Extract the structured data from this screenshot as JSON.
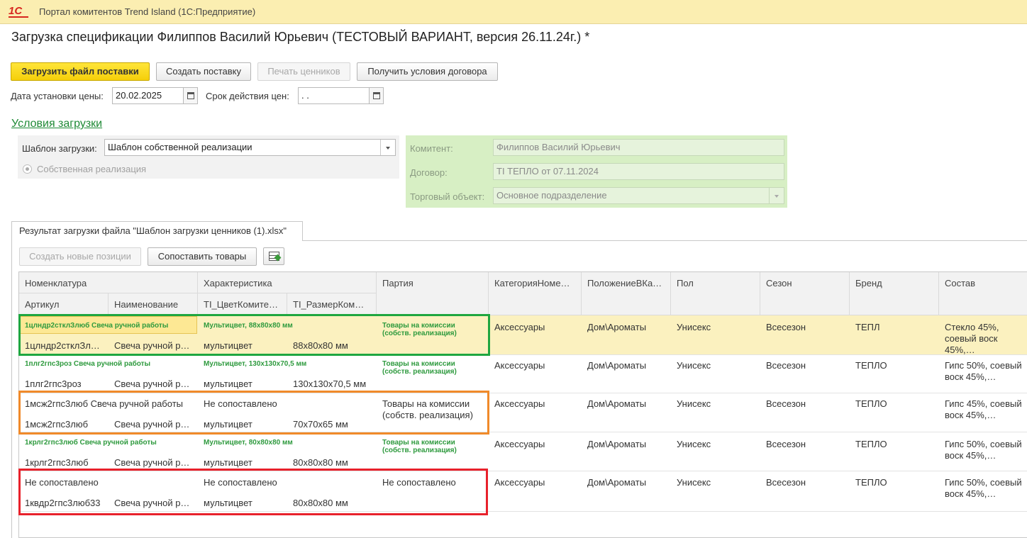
{
  "window": {
    "app_title": "Портал комитентов Trend Island  (1С:Предприятие)",
    "logo": "1С"
  },
  "document": {
    "title": "Загрузка спецификации Филиппов Василий Юрьевич (ТЕСТОВЫЙ ВАРИАНТ, версия 26.11.24г.) *"
  },
  "toolbar": {
    "load_file": "Загрузить файл поставки",
    "create_delivery": "Создать поставку",
    "print_labels": "Печать ценников",
    "get_conditions": "Получить условия договора"
  },
  "dates": {
    "price_date_label": "Дата установки цены:",
    "price_date_value": "20.02.2025",
    "valid_label": "Срок действия цен:",
    "valid_value": " .  ."
  },
  "conditions": {
    "link": "Условия загрузки",
    "template_label": "Шаблон загрузки:",
    "template_value": "Шаблон собственной реализации",
    "radio_label": "Собственная реализация",
    "consignor_label": "Комитент:",
    "consignor_value": "Филиппов Василий Юрьевич",
    "contract_label": "Договор:",
    "contract_value": "TI ТЕПЛО от 07.11.2024",
    "trade_label": "Торговый объект:",
    "trade_value": "Основное подразделение"
  },
  "result": {
    "tab": "Результат загрузки файла \"Шаблон загрузки ценников (1).xlsx\"",
    "create_new": "Создать новые позиции",
    "match_goods": "Сопоставить товары"
  },
  "table": {
    "headers": {
      "nomenclature": "Номенклатура",
      "characteristic": "Характеристика",
      "batch": "Партия",
      "category": "КатегорияНоме…",
      "position": "ПоложениеВКа…",
      "gender": "Пол",
      "season": "Сезон",
      "brand": "Бренд",
      "composition": "Состав",
      "article": "Артикул",
      "name": "Наименование",
      "color": "TI_ЦветКомите…",
      "size": "TI_РазмерКом…"
    },
    "rows": [
      {
        "nomen_top": "1цлндр2стклЗлюб Свеча ручной работы",
        "char_top": "Мультицвет, 88x80x80 мм",
        "batch": "Товары на комиссии (собств. реализация)",
        "article": "1цлндр2стклЗл…",
        "name": "Свеча ручной р…",
        "color": "мультицвет",
        "size": "88x80x80 мм",
        "category": "Аксессуары",
        "position": "Дом\\Ароматы",
        "gender": "Унисекс",
        "season": "Всесезон",
        "brand": "ТЕПЛ",
        "composition": "Стекло 45%, соевый воск 45%,…"
      },
      {
        "nomen_top": "1плг2гпс3роз Свеча ручной работы",
        "char_top": "Мультицвет, 130x130x70,5 мм",
        "batch": "Товары на комиссии (собств. реализация)",
        "article": "1плг2гпс3роз",
        "name": "Свеча ручной р…",
        "color": "мультицвет",
        "size": "130x130x70,5 мм",
        "category": "Аксессуары",
        "position": "Дом\\Ароматы",
        "gender": "Унисекс",
        "season": "Всесезон",
        "brand": "ТЕПЛО",
        "composition": "Гипс 50%, соевый воск 45%,…"
      },
      {
        "nomen_top": "1мсж2гпс3люб Свеча ручной работы",
        "char_top": "Не сопоставлено",
        "batch": "Товары на комиссии (собств. реализация)",
        "article": "1мсж2гпс3люб",
        "name": "Свеча ручной р…",
        "color": "мультицвет",
        "size": "70x70x65 мм",
        "category": "Аксессуары",
        "position": "Дом\\Ароматы",
        "gender": "Унисекс",
        "season": "Всесезон",
        "brand": "ТЕПЛО",
        "composition": "Гипс 45%, соевый воск 45%,…"
      },
      {
        "nomen_top": "1крлг2гпс3люб Свеча ручной работы",
        "char_top": "Мультицвет, 80x80x80 мм",
        "batch": "Товары на комиссии (собств. реализация)",
        "article": "1крлг2гпс3люб",
        "name": "Свеча ручной р…",
        "color": "мультицвет",
        "size": "80x80x80 мм",
        "category": "Аксессуары",
        "position": "Дом\\Ароматы",
        "gender": "Унисекс",
        "season": "Всесезон",
        "brand": "ТЕПЛО",
        "composition": "Гипс 50%, соевый воск 45%,…"
      },
      {
        "nomen_top": "Не сопоставлено",
        "char_top": "Не сопоставлено",
        "batch": "Не сопоставлено",
        "article": "1квдр2гпс3люб33",
        "name": "Свеча ручной р…",
        "color": "мультицвет",
        "size": "80x80x80 мм",
        "category": "Аксессуары",
        "position": "Дом\\Ароматы",
        "gender": "Унисекс",
        "season": "Всесезон",
        "brand": "ТЕПЛО",
        "composition": "Гипс 50%, соевый воск 45%,…"
      }
    ]
  },
  "colors": {
    "accent_yellow": "#f5cf0a",
    "green_link": "#1f8a36",
    "highlight_green": "#1fa640",
    "highlight_orange": "#f08a2a",
    "highlight_red": "#e8212b"
  }
}
